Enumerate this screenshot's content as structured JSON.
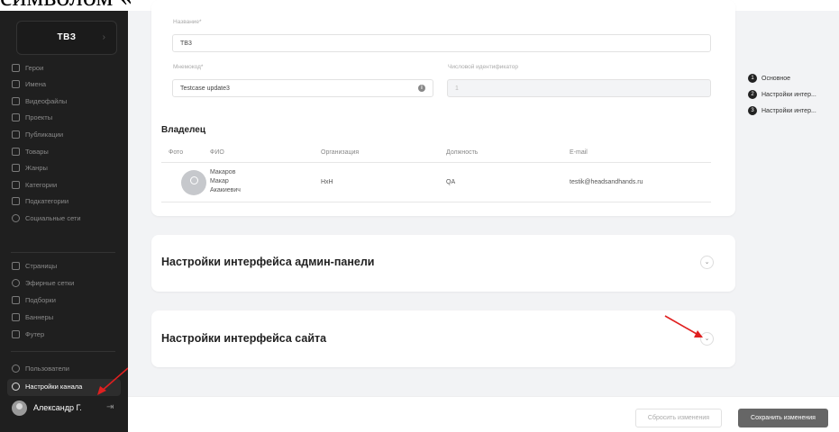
{
  "doc_crop_text": "символом «-»).",
  "sidebar": {
    "brand": "ТВЗ",
    "items": [
      {
        "label": "Герои"
      },
      {
        "label": "Имена"
      },
      {
        "label": "Видеофайлы"
      },
      {
        "label": "Проекты"
      },
      {
        "label": "Публикации"
      },
      {
        "label": "Товары"
      },
      {
        "label": "Жанры"
      },
      {
        "label": "Категории"
      },
      {
        "label": "Подкатегории"
      },
      {
        "label": "Социальные сети"
      },
      {
        "label": "Страницы"
      },
      {
        "label": "Эфирные сетки"
      },
      {
        "label": "Подборки"
      },
      {
        "label": "Баннеры"
      },
      {
        "label": "Футер"
      },
      {
        "label": "Пользователи"
      },
      {
        "label": "Настройки канала"
      }
    ],
    "user_name": "Александр Г."
  },
  "form": {
    "name_label": "Название*",
    "name_value": "ТВ3",
    "mnemonic_label": "Мнемокод*",
    "mnemonic_value": "Testcase update3",
    "numeric_id_label": "Числовой идентификатор",
    "numeric_id_value": "1"
  },
  "owner": {
    "title": "Владелец",
    "headers": {
      "photo": "Фото",
      "fio": "ФИО",
      "org": "Организация",
      "position": "Должность",
      "email": "E-mail"
    },
    "row": {
      "fio": "Макаров\nМакар\nАкакиевич",
      "org": "HxH",
      "position": "QA",
      "email": "testik@headsandhands.ru"
    }
  },
  "accordions": {
    "admin": "Настройки интерфейса админ-панели",
    "site": "Настройки интерфейса сайта"
  },
  "toc": [
    {
      "num": "1",
      "label": "Основное"
    },
    {
      "num": "2",
      "label": "Настройки интер..."
    },
    {
      "num": "3",
      "label": "Настройки интер..."
    }
  ],
  "actions": {
    "reset": "Сбросить изменения",
    "save": "Сохранить изменения"
  },
  "colors": {
    "sidebar_bg": "#1f1f1f",
    "page_bg": "#f2f3f5",
    "annotation_arrow": "#e02020"
  }
}
